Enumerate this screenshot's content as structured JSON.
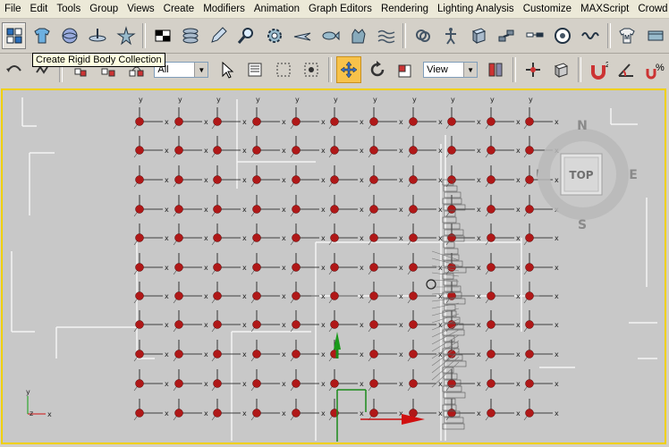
{
  "menu": [
    "File",
    "Edit",
    "Tools",
    "Group",
    "Views",
    "Create",
    "Modifiers",
    "Animation",
    "Graph Editors",
    "Rendering",
    "Lighting Analysis",
    "Customize",
    "MAXScript",
    "Crowd IT"
  ],
  "tooltip": "Create Rigid Body Collection",
  "toolbar2": {
    "selection_filter": "All",
    "reference_coord": "View"
  },
  "viewcube": {
    "face": "TOP",
    "north": "N",
    "south": "S",
    "east": "E",
    "west": "W"
  },
  "axis_gizmo": {
    "x": "x",
    "y": "y",
    "z": "z"
  },
  "colors": {
    "sphere": "#b01818",
    "viewport_border": "#f0d000",
    "viewport_bg": "#c8c8c8",
    "active_tool": "#f7c24a"
  },
  "icons_row1": [
    "rigid-body-collection-icon",
    "cloth-icon",
    "sphere-wrap-icon",
    "umbrella-icon",
    "star-icon",
    "checker-icon",
    "stack-icon",
    "pen-icon",
    "magnifier-icon",
    "gear-icon",
    "plane-icon",
    "fish-icon",
    "hand-icon",
    "waves-icon",
    "knot-icon",
    "figure-icon",
    "box-icon",
    "link-icon",
    "gear2-icon",
    "chain-icon",
    "max-icon",
    "film-icon"
  ],
  "icons_row2": [
    "undo-icon",
    "redo-icon",
    "link-tool-icon",
    "unlink-icon",
    "bind-icon",
    "select-icon",
    "select-by-name-icon",
    "rect-select-icon",
    "window-crossing-icon",
    "move-icon",
    "rotate-icon",
    "scale-icon",
    "mirror-icon",
    "pivot-icon",
    "snap-icon",
    "magnet-icon",
    "angle-snap-icon",
    "percent-snap-icon"
  ]
}
